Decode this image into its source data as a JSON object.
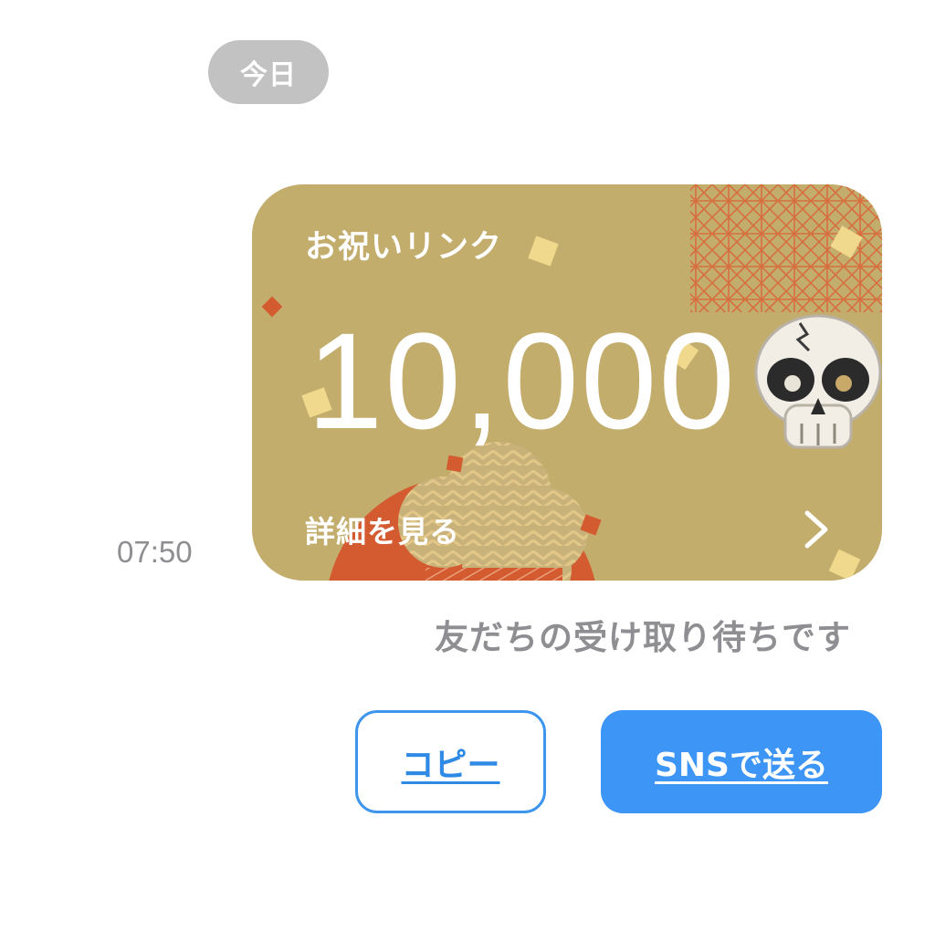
{
  "chat": {
    "date_label": "今日",
    "timestamp": "07:50"
  },
  "card": {
    "title": "お祝いリンク",
    "amount": "10,000",
    "details_label": "詳細を見る",
    "chevron_icon": "chevron-right-icon",
    "sticker_icon": "skull-icon",
    "colors": {
      "background": "#c3ad6d",
      "accent": "#d45a2f",
      "confetti": "#f0d98c"
    }
  },
  "status": {
    "text": "友だちの受け取り待ちです"
  },
  "actions": {
    "copy_label": "コピー",
    "sns_label": "SNSで送る",
    "colors": {
      "primary": "#3d95f5"
    }
  }
}
